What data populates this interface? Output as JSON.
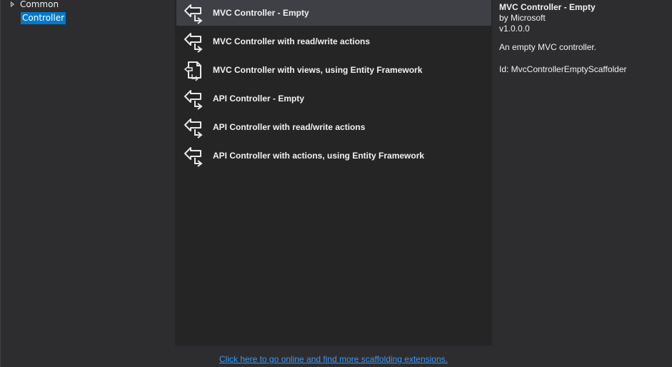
{
  "tree": {
    "items": [
      {
        "label": "Common",
        "expandable": true,
        "selected": false
      },
      {
        "label": "Controller",
        "expandable": false,
        "selected": true
      }
    ]
  },
  "list": {
    "items": [
      {
        "label": "MVC Controller - Empty",
        "icon": "controller-icon",
        "selected": true
      },
      {
        "label": "MVC Controller with read/write actions",
        "icon": "controller-icon",
        "selected": false
      },
      {
        "label": "MVC Controller with views, using Entity Framework",
        "icon": "controller-views-icon",
        "selected": false
      },
      {
        "label": "API Controller - Empty",
        "icon": "controller-icon",
        "selected": false
      },
      {
        "label": "API Controller with read/write actions",
        "icon": "controller-icon",
        "selected": false
      },
      {
        "label": "API Controller with actions, using Entity Framework",
        "icon": "controller-icon",
        "selected": false
      }
    ]
  },
  "details": {
    "title": "MVC Controller - Empty",
    "author": "by Microsoft",
    "version": "v1.0.0.0",
    "description": "An empty MVC controller.",
    "id": "Id: MvcControllerEmptyScaffolder"
  },
  "footer": {
    "link_text": "Click here to go online and find more scaffolding extensions."
  },
  "colors": {
    "background": "#2d2d30",
    "list_background": "#252526",
    "selection": "#3f3f46",
    "tree_selection": "#007acc",
    "link": "#3399ff"
  }
}
